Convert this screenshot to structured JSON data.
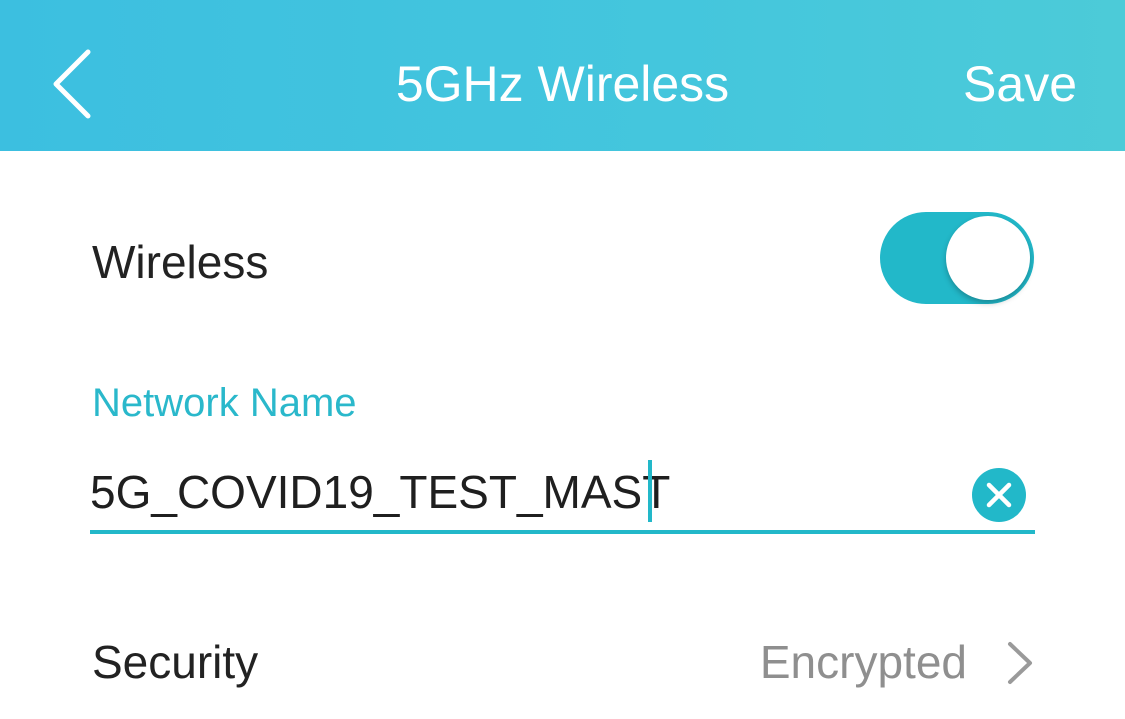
{
  "header": {
    "title": "5GHz Wireless",
    "save_label": "Save",
    "back_icon": "chevron-left-icon",
    "background_color": "#44c6dd"
  },
  "wireless": {
    "label": "Wireless",
    "enabled": true,
    "toggle_color": "#22b8c9"
  },
  "network_name": {
    "label": "Network Name",
    "value": "5G_COVID19_TEST_MAST",
    "clear_icon": "clear-circle-icon",
    "accent_color": "#22b8c9"
  },
  "security": {
    "label": "Security",
    "value": "Encrypted",
    "chevron_icon": "chevron-right-icon"
  }
}
